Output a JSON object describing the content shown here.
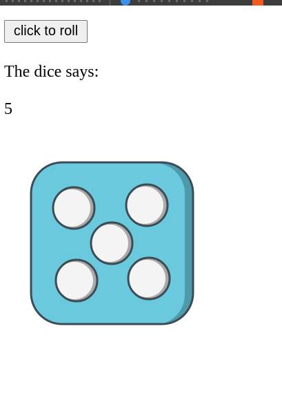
{
  "roll_button": {
    "label": "click to roll"
  },
  "result": {
    "heading": "The dice says:",
    "value": "5"
  },
  "dice": {
    "face_value": 5,
    "icon": "dice-five-icon",
    "face_color": "#6ac9dc",
    "shadow_color": "#4f9aaa",
    "outline_color": "#3d4b55",
    "pip_color": "#f4f4f4",
    "pip_shadow_color": "#a9a9a9"
  },
  "browser_strip": {
    "background": "#3c3c3c",
    "accent_blue": "#3a8fe8",
    "accent_orange": "#f25a22"
  }
}
